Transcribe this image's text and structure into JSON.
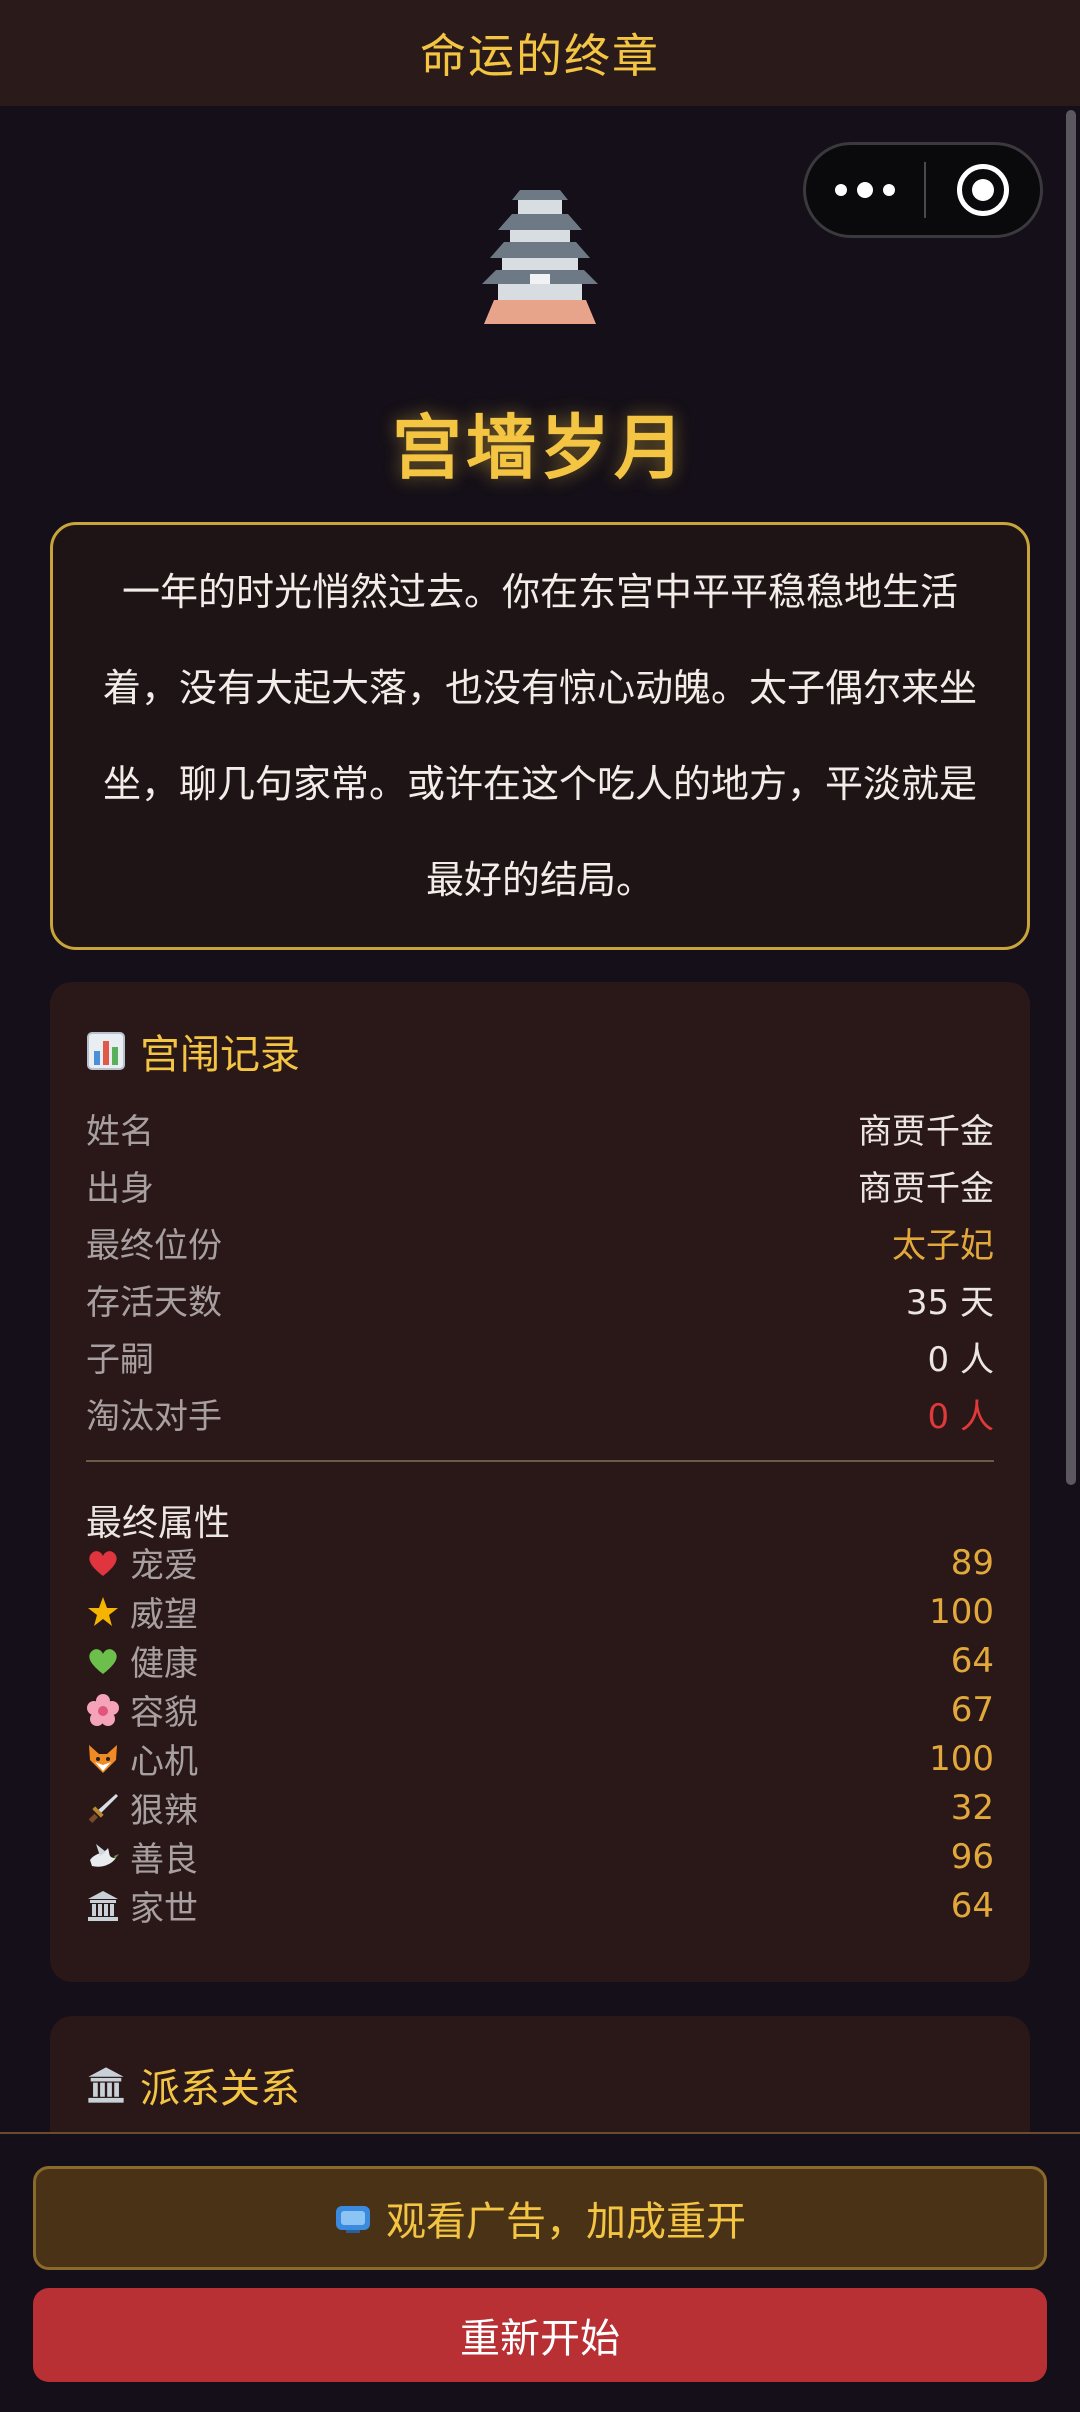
{
  "nav": {
    "title": "命运的终章"
  },
  "hero": {
    "icon": "castle-icon",
    "heading": "宫墙岁月"
  },
  "ending": {
    "text": "一年的时光悄然过去。你在东宫中平平稳稳地生活着，没有大起大落，也没有惊心动魄。太子偶尔来坐坐，聊几句家常。或许在这个吃人的地方，平淡就是最好的结局。"
  },
  "records": {
    "title": "宫闱记录",
    "icon": "bar-chart-icon",
    "rows": [
      {
        "label": "姓名",
        "value": "商贾千金"
      },
      {
        "label": "出身",
        "value": "商贾千金"
      },
      {
        "label": "最终位份",
        "value": "太子妃"
      },
      {
        "label": "存活天数",
        "value": "35 天"
      },
      {
        "label": "子嗣",
        "value": "0 人"
      },
      {
        "label": "淘汰对手",
        "value": "0 人"
      }
    ],
    "attributes_title": "最终属性",
    "attributes": [
      {
        "icon": "heart-icon",
        "label": "宠爱",
        "value": "89"
      },
      {
        "icon": "star-icon",
        "label": "威望",
        "value": "100"
      },
      {
        "icon": "green-heart-icon",
        "label": "健康",
        "value": "64"
      },
      {
        "icon": "flower-icon",
        "label": "容貌",
        "value": "67"
      },
      {
        "icon": "fox-icon",
        "label": "心机",
        "value": "100"
      },
      {
        "icon": "dagger-icon",
        "label": "狠辣",
        "value": "32"
      },
      {
        "icon": "dove-icon",
        "label": "善良",
        "value": "96"
      },
      {
        "icon": "classical-building-icon",
        "label": "家世",
        "value": "64"
      }
    ]
  },
  "faction": {
    "title": "派系关系",
    "icon": "classical-building-icon"
  },
  "buttons": {
    "ad": "观看广告，加成重开",
    "ad_icon": "tv-icon",
    "restart": "重新开始"
  },
  "colors": {
    "accent": "#f4c542",
    "danger": "#e0393a",
    "card": "#2a1819",
    "restart": "#b83034"
  }
}
